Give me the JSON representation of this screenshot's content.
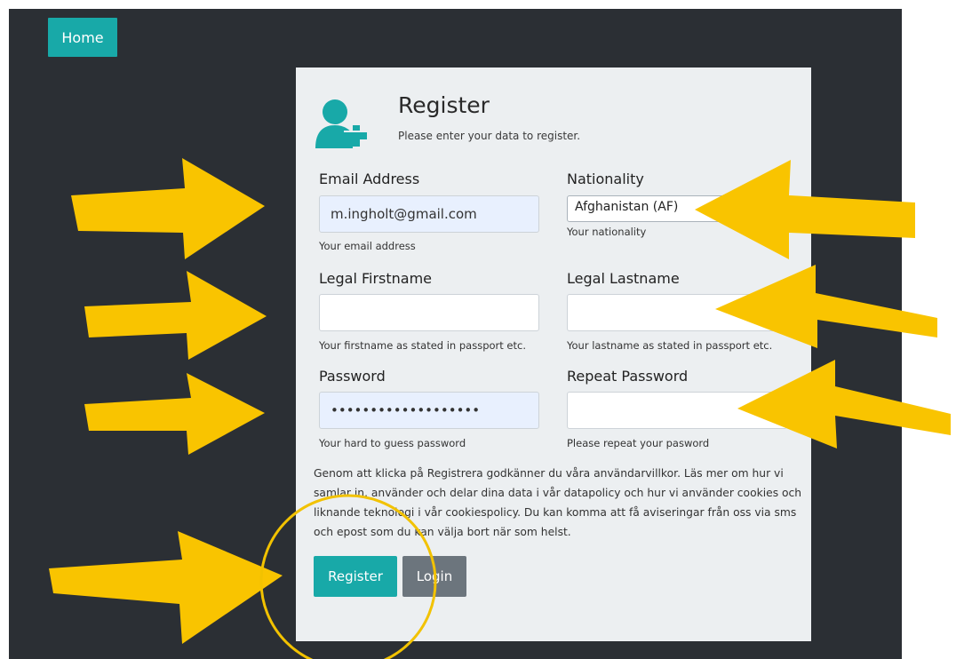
{
  "nav": {
    "home_label": "Home"
  },
  "form": {
    "title": "Register",
    "subtitle": "Please enter your data to register.",
    "email": {
      "label": "Email Address",
      "value": "m.ingholt@gmail.com",
      "help": "Your email address"
    },
    "nationality": {
      "label": "Nationality",
      "selected": "Afghanistan (AF)",
      "help": "Your nationality"
    },
    "firstname": {
      "label": "Legal Firstname",
      "value": "",
      "help": "Your firstname as stated in passport etc."
    },
    "lastname": {
      "label": "Legal Lastname",
      "value": "",
      "help": "Your lastname as stated in passport etc."
    },
    "password": {
      "label": "Password",
      "value": "•••••••••••••••••••",
      "help": "Your hard to guess password"
    },
    "repeat_password": {
      "label": "Repeat Password",
      "value": "",
      "help": "Please repeat your pasword"
    },
    "terms": "Genom att klicka på Registrera godkänner du våra användarvillkor. Läs mer om hur vi samlar in, använder och delar dina data i vår datapolicy och hur vi använder cookies och liknande teknologi i vår cookiespolicy. Du kan komma att få aviseringar från oss via sms och epost som du kan välja bort när som helst.",
    "register_label": "Register",
    "login_label": "Login"
  },
  "annotations": {
    "arrow_color": "#f9c400",
    "circle_color": "#f2c200"
  },
  "icons": {
    "user_add": "user-plus-icon"
  }
}
